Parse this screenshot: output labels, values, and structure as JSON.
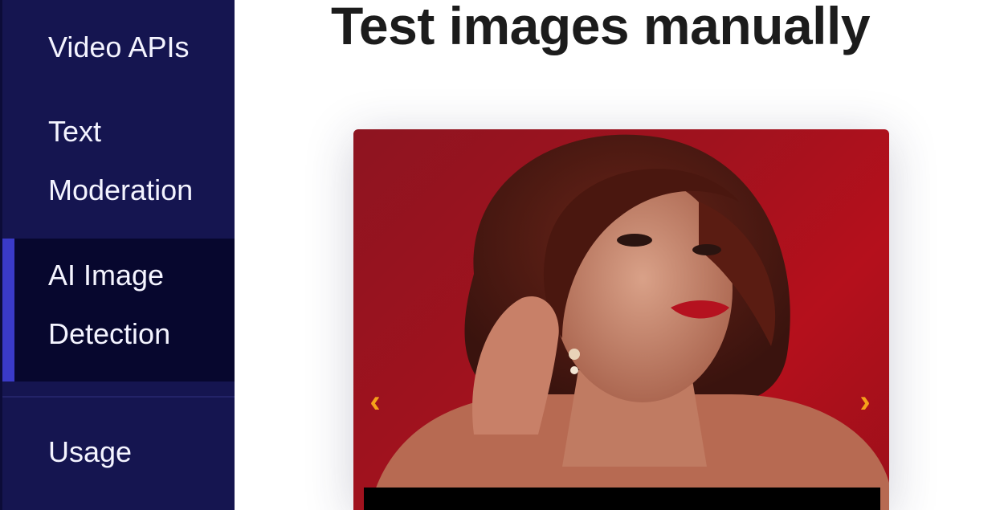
{
  "sidebar": {
    "items": [
      {
        "label": "Video APIs"
      },
      {
        "label_line1": "Text",
        "label_line2": "Moderation"
      },
      {
        "label_line1": "AI Image",
        "label_line2": "Detection",
        "active": true
      },
      {
        "label": "Usage"
      }
    ],
    "colors": {
      "background": "#151550",
      "active_background": "#07072e",
      "active_accent": "#3a3ac8"
    }
  },
  "main": {
    "title": "Test images manually",
    "carousel": {
      "prev_icon": "chevron-left-icon",
      "next_icon": "chevron-right-icon",
      "prev_glyph": "‹",
      "next_glyph": "›",
      "arrow_color": "#f5a21a"
    }
  }
}
